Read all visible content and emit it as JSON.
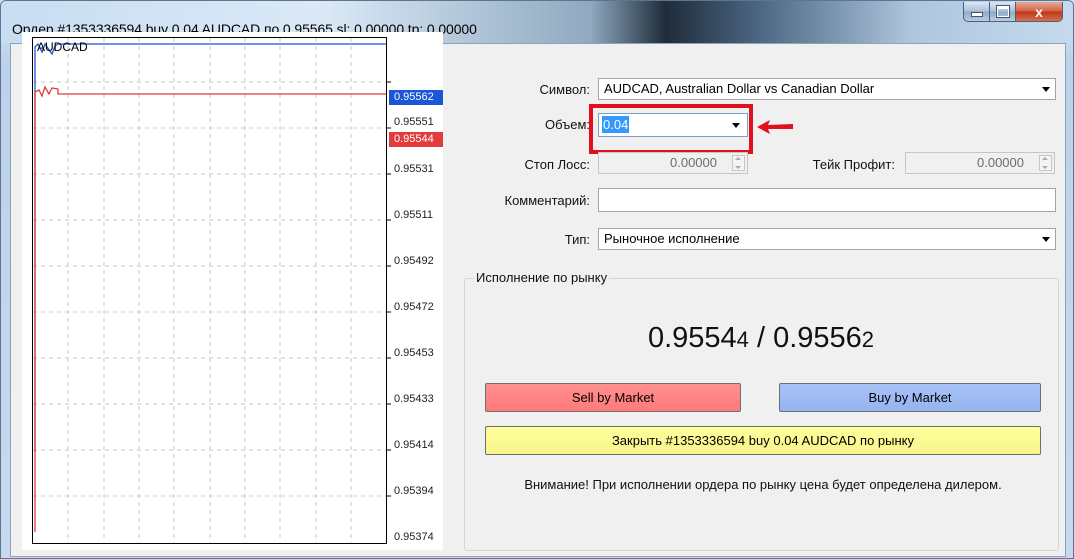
{
  "window": {
    "title": "Ордер #1353336594 buy 0.04 AUDCAD по 0.95565 sl: 0.00000 tp: 0.00000",
    "controls": [
      "minimize-icon",
      "maximize-icon",
      "close-icon"
    ],
    "close_glyph": "x"
  },
  "chart": {
    "symbol": "AUDCAD",
    "ask_price": "0.95562",
    "bid_price": "0.95544",
    "ask_color": "#1a56d6",
    "bid_color": "#e23b3b",
    "price_labels": [
      "0.95551",
      "0.95531",
      "0.95511",
      "0.95492",
      "0.95472",
      "0.95453",
      "0.95433",
      "0.95414",
      "0.95394",
      "0.95374"
    ]
  },
  "form": {
    "symbol_label": "Символ:",
    "symbol_value": "AUDCAD, Australian Dollar vs Canadian Dollar",
    "volume_label": "Объем:",
    "volume_value": "0.04",
    "stoploss_label": "Стоп Лосс:",
    "stoploss_value": "0.00000",
    "takeprofit_label": "Тейк Профит:",
    "takeprofit_value": "0.00000",
    "comment_label": "Комментарий:",
    "comment_value": "",
    "type_label": "Тип:",
    "type_value": "Рыночное исполнение"
  },
  "market": {
    "group_title": "Исполнение по рынку",
    "bid_main": "0.9554",
    "bid_last": "4",
    "separator": " / ",
    "ask_main": "0.9556",
    "ask_last": "2",
    "sell_label": "Sell by Market",
    "buy_label": "Buy by Market",
    "close_label": "Закрыть #1353336594 buy 0.04 AUDCAD по рынку",
    "warning": "Внимание! При исполнении ордера по рынку цена будет определена дилером.",
    "sell_color": "#ff7f7f",
    "buy_color": "#9cb9f2",
    "close_color": "#fafa90",
    "highlight_color": "#e0101c"
  }
}
